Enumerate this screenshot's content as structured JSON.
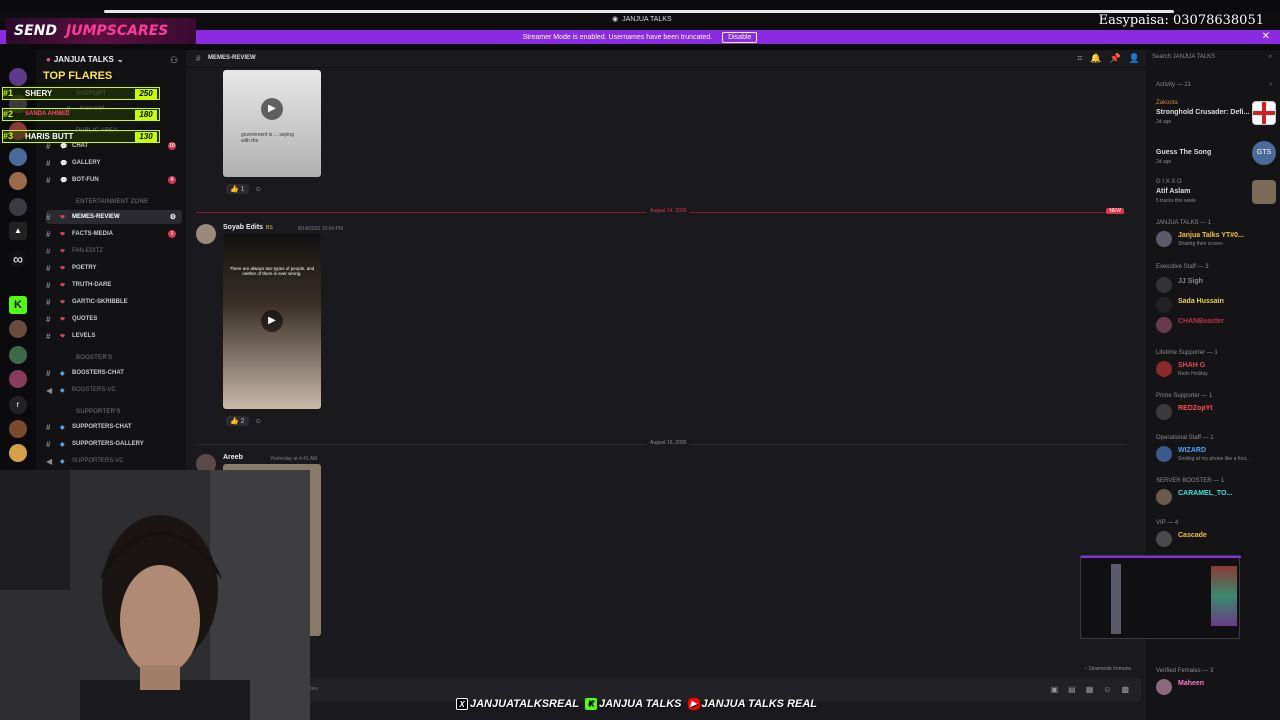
{
  "window": {
    "title": "JANJUA TALKS"
  },
  "banner": {
    "text": "Streamer Mode is enabled. Usernames have been truncated.",
    "disable_label": "Disable",
    "close": "✕"
  },
  "overlay": {
    "send_a": "SEND",
    "send_b": "JUMPSCARES",
    "easypaisa": "Easypaisa: 03078638051",
    "flares_title": "TOP FLARES",
    "flares": [
      {
        "rank": "#1",
        "name": "SHERY",
        "score": "250"
      },
      {
        "rank": "#2",
        "name": "SANDA AHMED",
        "score": "180"
      },
      {
        "rank": "#3",
        "name": "HARIS BUTT",
        "score": "130"
      }
    ]
  },
  "server": {
    "name": "JANJUA TALKS"
  },
  "sidebar": {
    "categories": {
      "support": "SUPPORT",
      "public": "PUBLIC AREA",
      "entertainment": "ENTERTAINMENT ZONE",
      "boosters": "BOOSTER'S",
      "supporters": "SUPPORTER'S"
    },
    "channels": [
      {
        "label": "transcript"
      },
      {
        "label": "CHAT",
        "badge": "10"
      },
      {
        "label": "GALLERY"
      },
      {
        "label": "BOT-FUN",
        "badge": "4"
      },
      {
        "label": "MEMES-REVIEW"
      },
      {
        "label": "FACTS-MEDIA",
        "badge": "1"
      },
      {
        "label": "FAN-EDITZ"
      },
      {
        "label": "POETRY"
      },
      {
        "label": "TRUTH-DARE"
      },
      {
        "label": "GARTIC-SKRIBBLE"
      },
      {
        "label": "QUOTES"
      },
      {
        "label": "LEVELS"
      },
      {
        "label": "BOOSTERS-CHAT"
      },
      {
        "label": "BOOSTERS-VC"
      },
      {
        "label": "SUPPORTERS-CHAT"
      },
      {
        "label": "SUPPORTERS-GALLERY"
      },
      {
        "label": "SUPPORTERS-VC"
      }
    ]
  },
  "main": {
    "channel": "MEMES-REVIEW",
    "messages": [
      {
        "reaction_count": "1",
        "caption": "government is ... saying with the"
      },
      {
        "author": "Soyab Edits",
        "tag": "BS",
        "time": "8/14/2026 10:04 PM",
        "caption": "There are always two types of people, and neither of them is ever wrong.",
        "reaction_count": "2"
      },
      {
        "author": "Areeb",
        "time": "Yesterday at 4:41 AM"
      }
    ],
    "dividers": {
      "d1": "August 14, 2026",
      "d2": "August 16, 2026",
      "new": "NEW"
    },
    "composer_slowmode": "Slowmode Immune",
    "composer_placeholder": "view"
  },
  "members": {
    "search_placeholder": "Search JANJUA TALKS",
    "activity_label": "Activity — 21",
    "activities": [
      {
        "user": "Zakoota",
        "title": "Stronghold Crusader: Defi...",
        "sub": "2d ago"
      },
      {
        "user": "",
        "title": "Guess The Song",
        "sub": "2d ago"
      },
      {
        "user": "G I X X O",
        "title": "Atif Aslam",
        "sub": "5 tracks this week"
      }
    ],
    "sections": [
      {
        "label": "JANJUA TALKS — 1",
        "members": [
          {
            "name": "Janjua Talks YT#0...",
            "status": "Sharing their screen",
            "color": "#f0c040"
          }
        ]
      },
      {
        "label": "Executive Staff — 3",
        "members": [
          {
            "name": "JJ Sigh",
            "status": "",
            "color": "#8a8a92"
          },
          {
            "name": "Sada Hussain",
            "status": "",
            "color": "#f0d050"
          },
          {
            "name": "CHANBeaster",
            "status": "",
            "color": "#c03048"
          }
        ]
      },
      {
        "label": "Lifetime Supporter — 1",
        "members": [
          {
            "name": "SHAH G",
            "status": "Redx Holiday",
            "color": "#e04a4a"
          }
        ]
      },
      {
        "label": "Prime Supporter — 1",
        "members": [
          {
            "name": "REDZopYt",
            "status": "",
            "color": "#ff4a4a"
          }
        ]
      },
      {
        "label": "Operational Staff — 1",
        "members": [
          {
            "name": "WIZARD",
            "status": "Smiling at my phone like a fool...",
            "color": "#4aa8ff"
          }
        ]
      },
      {
        "label": "SERVER BOOSTER — 1",
        "members": [
          {
            "name": "CARAMEL_TO...",
            "status": "",
            "color": "#40e0e0"
          }
        ]
      },
      {
        "label": "VIP — 4",
        "members": [
          {
            "name": "Cascade",
            "status": "",
            "color": "#f0c040"
          }
        ]
      },
      {
        "label": "Verified Females — 3",
        "members": [
          {
            "name": "Maheen",
            "status": "",
            "color": "#ff7ad0"
          }
        ]
      }
    ]
  },
  "socials": [
    {
      "icon": "x-icon",
      "glyph": "X",
      "label": "JANJUATALKSREAL"
    },
    {
      "icon": "kick-icon",
      "glyph": "K",
      "label": "JANJUA TALKS"
    },
    {
      "icon": "youtube-icon",
      "glyph": "▶",
      "label": "JANJUA TALKS REAL"
    }
  ],
  "colors": {
    "accent": "#8a2be2",
    "brand_red": "#e0334b",
    "flare_green": "#c8ff00"
  }
}
